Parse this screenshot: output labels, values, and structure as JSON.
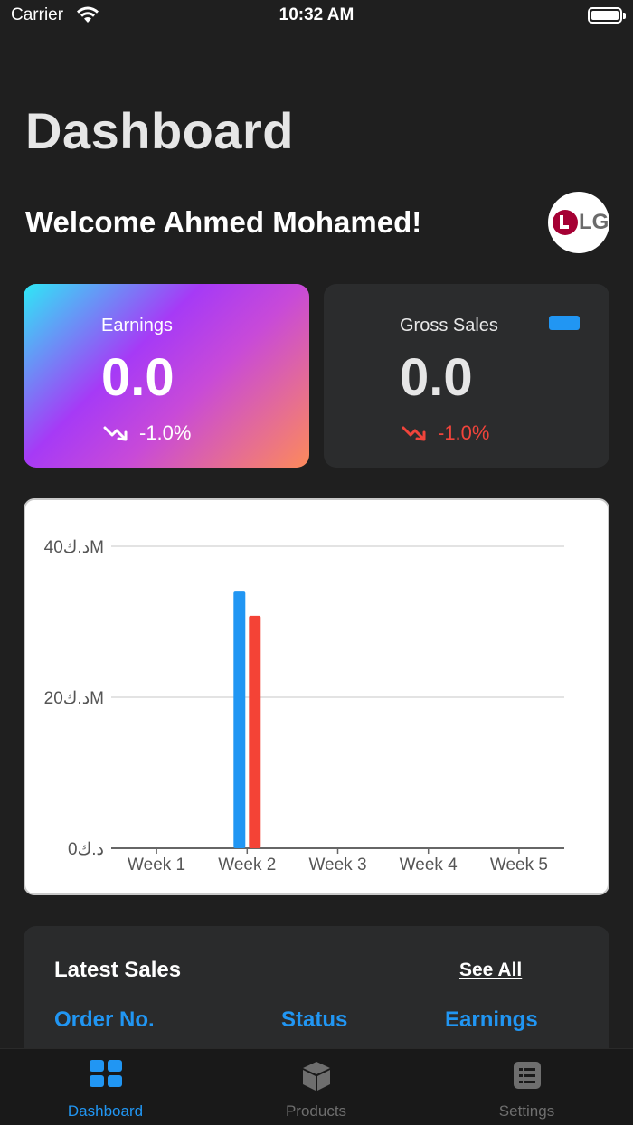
{
  "status_bar": {
    "carrier": "Carrier",
    "time": "10:32 AM"
  },
  "page": {
    "title": "Dashboard",
    "welcome": "Welcome Ahmed Mohamed!",
    "brand_logo_text": "LG"
  },
  "cards": {
    "earnings": {
      "label": "Earnings",
      "value": "0.0",
      "change": "-1.0%"
    },
    "gross_sales": {
      "label": "Gross Sales",
      "value": "0.0",
      "change": "-1.0%"
    }
  },
  "colors": {
    "accent": "#2196f3",
    "negative": "#f0443b",
    "background": "#1f1f1f",
    "card": "#2b2c2d"
  },
  "chart_data": {
    "type": "bar",
    "categories": [
      "Week 1",
      "Week 2",
      "Week 3",
      "Week 4",
      "Week 5"
    ],
    "series": [
      {
        "color": "#2196f3",
        "values": [
          0,
          34,
          0,
          0,
          0
        ]
      },
      {
        "color": "#f44336",
        "values": [
          0,
          30.8,
          0,
          0,
          0
        ]
      }
    ],
    "y_ticks": [
      {
        "value": 0,
        "label": "0د.ك"
      },
      {
        "value": 20,
        "label": "20د.كM"
      },
      {
        "value": 40,
        "label": "40د.كM"
      }
    ],
    "ylim": [
      0,
      40
    ],
    "grid": true
  },
  "latest_sales": {
    "title": "Latest Sales",
    "see_all": "See All",
    "columns": [
      "Order No.",
      "Status",
      "Earnings"
    ]
  },
  "tabs": [
    {
      "label": "Dashboard",
      "icon": "grid-icon",
      "active": true
    },
    {
      "label": "Products",
      "icon": "box-icon",
      "active": false
    },
    {
      "label": "Settings",
      "icon": "list-icon",
      "active": false
    }
  ]
}
